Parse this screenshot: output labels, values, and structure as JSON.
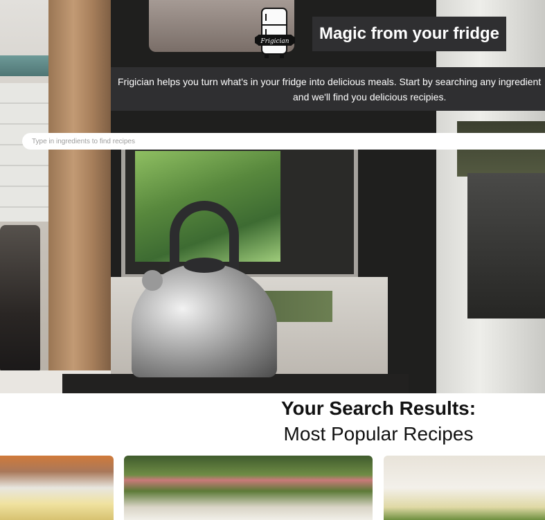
{
  "app": {
    "logo_text": "Frigician",
    "hero_title": "Magic from your fridge",
    "tagline_line1": "Frigician helps you turn what's in your fridge into delicious meals. Start by searching any ingredient",
    "tagline_line2": "and we'll find you delicious recipies."
  },
  "search": {
    "placeholder": "Type in ingredients to find recipes",
    "value": ""
  },
  "results": {
    "title": "Your Search Results:",
    "subtitle": "Most Popular Recipes"
  },
  "colors": {
    "banner_bg": "#2f2f31",
    "banner_text": "#ffffff",
    "page_bg": "#ffffff"
  }
}
